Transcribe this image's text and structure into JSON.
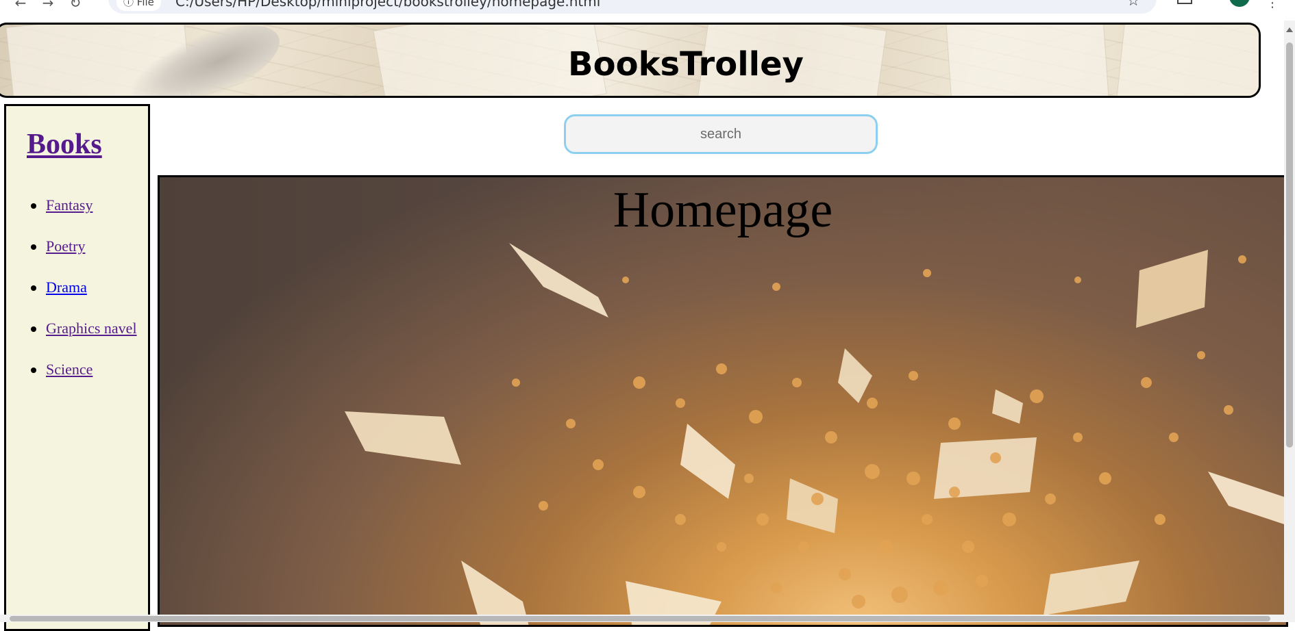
{
  "browser": {
    "site_badge": "File",
    "url": "C:/Users/HP/Desktop/miniproject/bookstrolley/homepage.html"
  },
  "header": {
    "title": "BooksTrolley"
  },
  "sidebar": {
    "heading": "Books",
    "items": [
      {
        "label": "Fantasy",
        "visited": true
      },
      {
        "label": "Poetry",
        "visited": true
      },
      {
        "label": "Drama",
        "visited": false
      },
      {
        "label": "Graphics navel",
        "visited": true
      },
      {
        "label": "Science",
        "visited": true
      }
    ]
  },
  "search": {
    "placeholder": "search",
    "value": ""
  },
  "main": {
    "title": "Homepage",
    "image_subject": "flying-book-pages-illustration"
  },
  "colors": {
    "sidebar_bg": "#f4f4df",
    "visited_link": "#551a8b",
    "unvisited_link": "#0000ee",
    "search_border": "#8ccfee"
  }
}
